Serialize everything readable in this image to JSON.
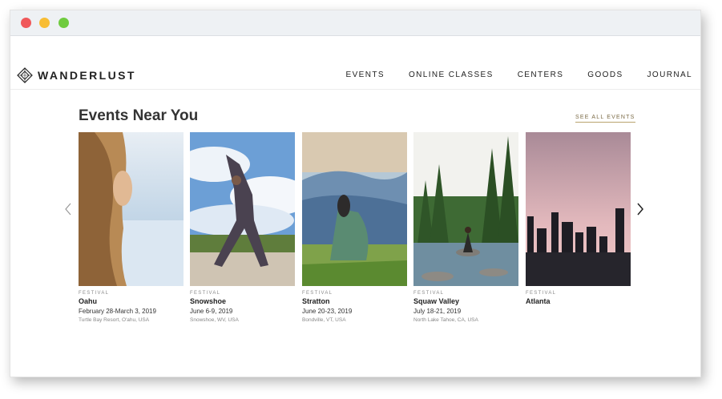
{
  "window": {
    "buttons": [
      "close",
      "minimize",
      "maximize"
    ]
  },
  "brand": {
    "name": "WANDERLUST",
    "logo_icon": "diamond-logo-icon"
  },
  "nav": {
    "items": [
      {
        "label": "EVENTS"
      },
      {
        "label": "ONLINE CLASSES"
      },
      {
        "label": "CENTERS"
      },
      {
        "label": "GOODS"
      },
      {
        "label": "JOURNAL"
      }
    ]
  },
  "section": {
    "title": "Events Near You",
    "see_all": "SEE ALL EVENTS",
    "prev_icon": "chevron-left-icon",
    "next_icon": "chevron-right-icon"
  },
  "events": [
    {
      "category": "FESTIVAL",
      "name": "Oahu",
      "dates": "February 28-March 3, 2019",
      "location": "Turtle Bay Resort, O'ahu, USA"
    },
    {
      "category": "FESTIVAL",
      "name": "Snowshoe",
      "dates": "June 6-9, 2019",
      "location": "Snowshoe, WV, USA"
    },
    {
      "category": "FESTIVAL",
      "name": "Stratton",
      "dates": "June 20-23, 2019",
      "location": "Bondville, VT, USA"
    },
    {
      "category": "FESTIVAL",
      "name": "Squaw Valley",
      "dates": "July 18-21, 2019",
      "location": "North Lake Tahoe, CA, USA"
    },
    {
      "category": "FESTIVAL",
      "name": "Atlanta",
      "dates": "",
      "location": ""
    }
  ],
  "colors": {
    "accent": "#b9a46e",
    "titlebar": "#eef1f4",
    "close": "#f0585a",
    "minimize": "#f8bd34",
    "maximize": "#6fcb3f"
  }
}
